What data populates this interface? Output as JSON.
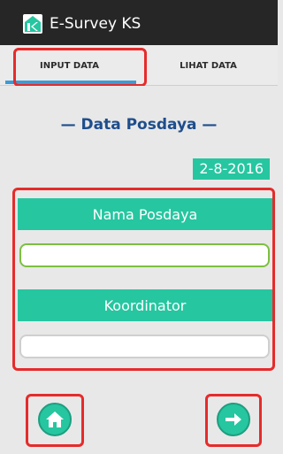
{
  "app": {
    "title": "E-Survey KS"
  },
  "tabs": [
    {
      "label": "INPUT DATA",
      "selected": true
    },
    {
      "label": "LIHAT DATA",
      "selected": false
    }
  ],
  "section": {
    "title": "— Data Posdaya —"
  },
  "date": "2-8-2016",
  "form": {
    "fields": [
      {
        "label": "Nama Posdaya",
        "value": "",
        "placeholder": ""
      },
      {
        "label": "Koordinator",
        "value": "",
        "placeholder": ""
      }
    ]
  },
  "nav": {
    "home_icon": "home-icon",
    "next_icon": "arrow-right-icon"
  },
  "colors": {
    "accent": "#26c6a0",
    "highlight": "#e62b2b",
    "tab_indicator": "#3b9bd7",
    "section_title": "#1e4e8c"
  }
}
